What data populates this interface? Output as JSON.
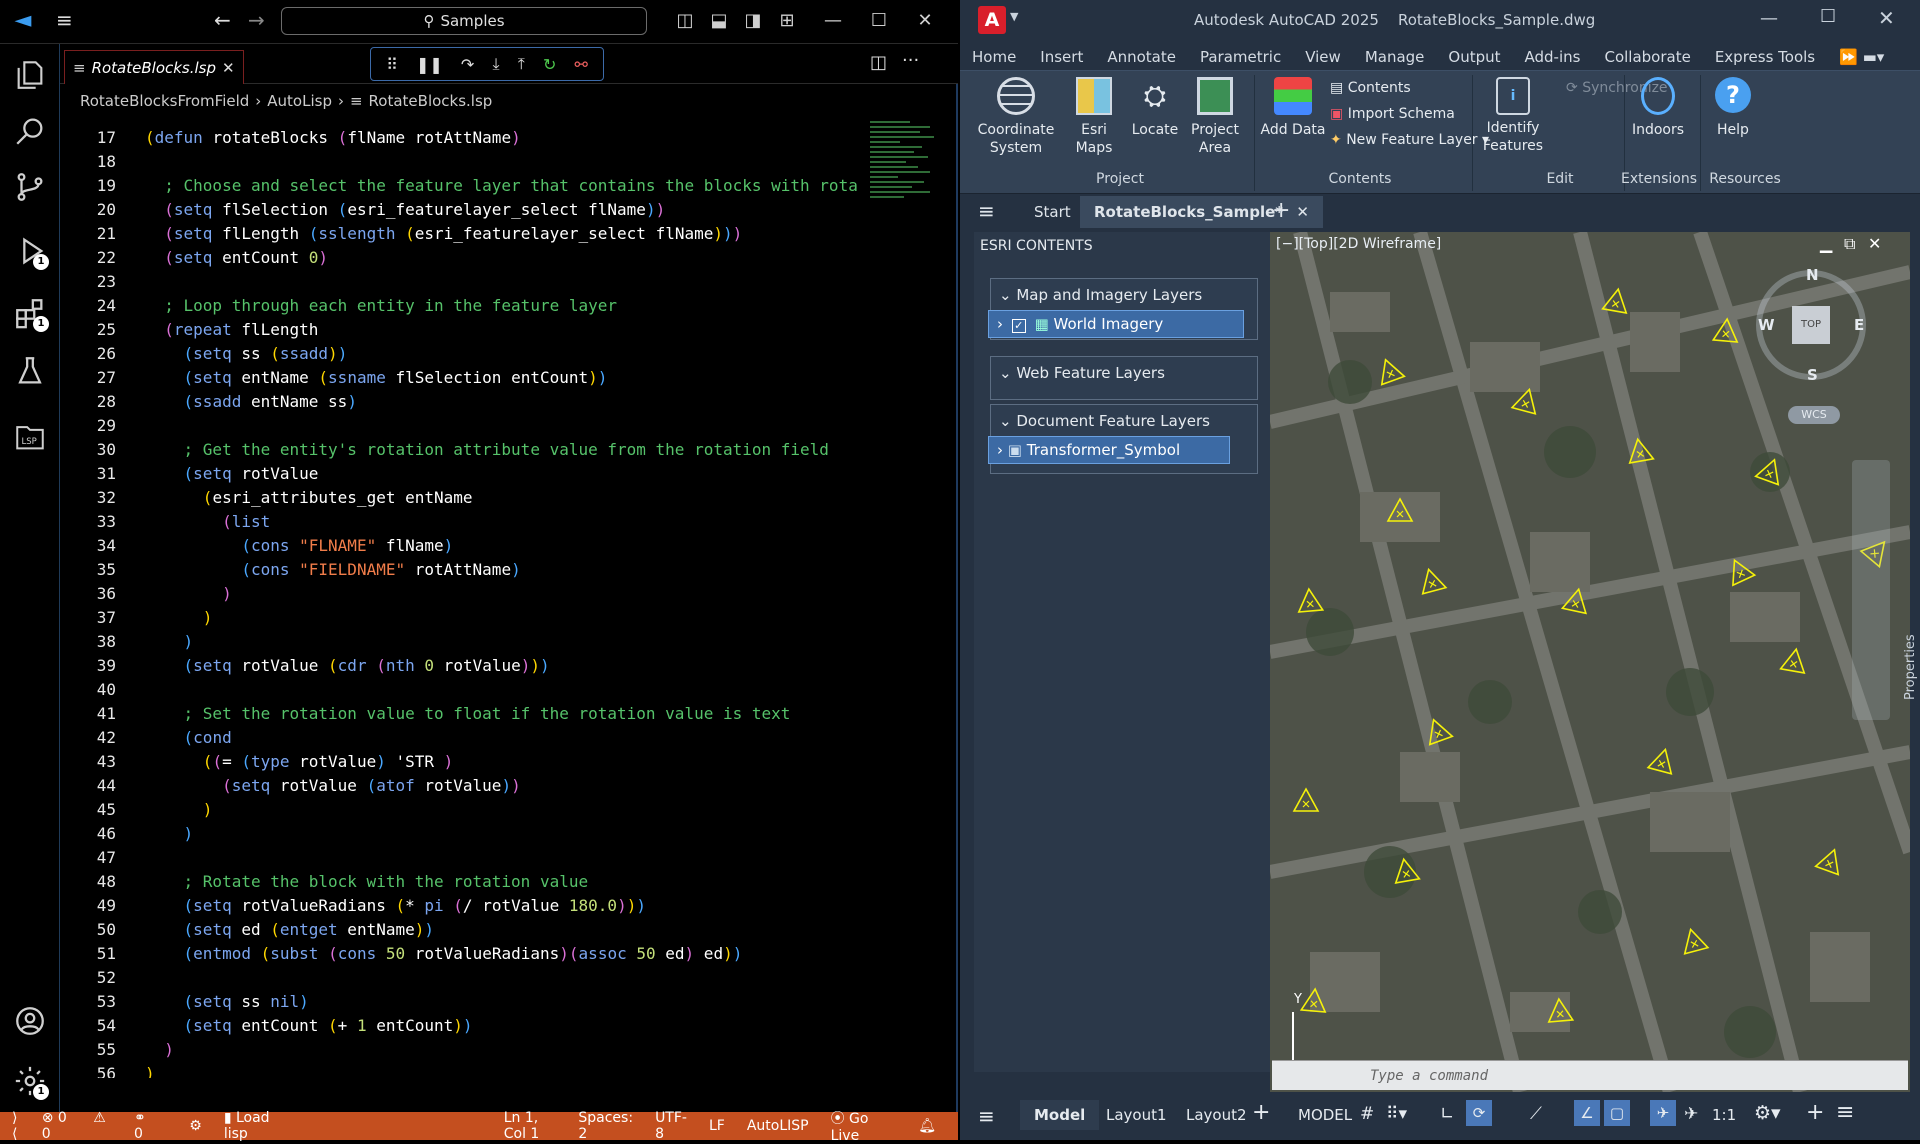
{
  "vscode": {
    "search_label": "Samples",
    "tab": {
      "filename": "RotateBlocks.lsp",
      "close": "✕"
    },
    "breadcrumb": [
      "RotateBlocksFromField",
      "AutoLisp",
      "RotateBlocks.lsp"
    ],
    "activity_badges": {
      "run": "1",
      "extensions": "1",
      "settings": "1"
    },
    "code_lines": [
      {
        "n": "17",
        "html": "<span class='p1'>(</span><span class='kw'>defun</span> rotateBlocks <span class='p2'>(</span>flName rotAttName<span class='p2'>)</span>"
      },
      {
        "n": "18",
        "html": ""
      },
      {
        "n": "19",
        "html": "  <span class='cm'>; Choose and select the feature layer that contains the blocks with rota</span>"
      },
      {
        "n": "20",
        "html": "  <span class='p2'>(</span><span class='kw'>setq</span> flSelection <span class='p3'>(</span>esri_featurelayer_select flName<span class='p3'>)</span><span class='p2'>)</span>"
      },
      {
        "n": "21",
        "html": "  <span class='p2'>(</span><span class='kw'>setq</span> flLength <span class='p3'>(</span><span class='kw'>sslength</span> <span class='p1'>(</span>esri_featurelayer_select flName<span class='p1'>)</span><span class='p3'>)</span><span class='p2'>)</span>"
      },
      {
        "n": "22",
        "html": "  <span class='p2'>(</span><span class='kw'>setq</span> entCount <span class='nm'>0</span><span class='p2'>)</span>"
      },
      {
        "n": "23",
        "html": ""
      },
      {
        "n": "24",
        "html": "  <span class='cm'>; Loop through each entity in the feature layer</span>"
      },
      {
        "n": "25",
        "html": "  <span class='p2'>(</span><span class='kw'>repeat</span> flLength"
      },
      {
        "n": "26",
        "html": "    <span class='p3'>(</span><span class='kw'>setq</span> ss <span class='p1'>(</span><span class='kw'>ssadd</span><span class='p1'>)</span><span class='p3'>)</span>"
      },
      {
        "n": "27",
        "html": "    <span class='p3'>(</span><span class='kw'>setq</span> entName <span class='p1'>(</span><span class='kw'>ssname</span> flSelection entCount<span class='p1'>)</span><span class='p3'>)</span>"
      },
      {
        "n": "28",
        "html": "    <span class='p3'>(</span><span class='kw'>ssadd</span> entName ss<span class='p3'>)</span>"
      },
      {
        "n": "29",
        "html": ""
      },
      {
        "n": "30",
        "html": "    <span class='cm'>; Get the entity's rotation attribute value from the rotation field</span>"
      },
      {
        "n": "31",
        "html": "    <span class='p3'>(</span><span class='kw'>setq</span> rotValue"
      },
      {
        "n": "32",
        "html": "      <span class='p1'>(</span>esri_attributes_get entName"
      },
      {
        "n": "33",
        "html": "        <span class='p2'>(</span><span class='kw'>list</span>"
      },
      {
        "n": "34",
        "html": "          <span class='p3'>(</span><span class='kw'>cons</span> <span class='st'>\"FLNAME\"</span> flName<span class='p3'>)</span>"
      },
      {
        "n": "35",
        "html": "          <span class='p3'>(</span><span class='kw'>cons</span> <span class='st'>\"FIELDNAME\"</span> rotAttName<span class='p3'>)</span>"
      },
      {
        "n": "36",
        "html": "        <span class='p2'>)</span>"
      },
      {
        "n": "37",
        "html": "      <span class='p1'>)</span>"
      },
      {
        "n": "38",
        "html": "    <span class='p3'>)</span>"
      },
      {
        "n": "39",
        "html": "    <span class='p3'>(</span><span class='kw'>setq</span> rotValue <span class='p1'>(</span><span class='kw'>cdr</span> <span class='p2'>(</span><span class='kw'>nth</span> <span class='nm'>0</span> rotValue<span class='p2'>)</span><span class='p1'>)</span><span class='p3'>)</span>"
      },
      {
        "n": "40",
        "html": ""
      },
      {
        "n": "41",
        "html": "    <span class='cm'>; Set the rotation value to float if the rotation value is text</span>"
      },
      {
        "n": "42",
        "html": "    <span class='p3'>(</span><span class='kw'>cond</span>"
      },
      {
        "n": "43",
        "html": "      <span class='p1'>(</span><span class='p2'>(</span>= <span class='p3'>(</span><span class='kw'>type</span> rotValue<span class='p3'>)</span> 'STR <span class='p2'>)</span>"
      },
      {
        "n": "44",
        "html": "        <span class='p2'>(</span><span class='kw'>setq</span> rotValue <span class='p3'>(</span><span class='kw'>atof</span> rotValue<span class='p3'>)</span><span class='p2'>)</span>"
      },
      {
        "n": "45",
        "html": "      <span class='p1'>)</span>"
      },
      {
        "n": "46",
        "html": "    <span class='p3'>)</span>"
      },
      {
        "n": "47",
        "html": ""
      },
      {
        "n": "48",
        "html": "    <span class='cm'>; Rotate the block with the rotation value</span>"
      },
      {
        "n": "49",
        "html": "    <span class='p3'>(</span><span class='kw'>setq</span> rotValueRadians <span class='p1'>(</span>* <span class='kw'>pi</span> <span class='p2'>(</span>/ rotValue <span class='nm'>180.0</span><span class='p2'>)</span><span class='p1'>)</span><span class='p3'>)</span>"
      },
      {
        "n": "50",
        "html": "    <span class='p3'>(</span><span class='kw'>setq</span> ed <span class='p1'>(</span><span class='kw'>entget</span> entName<span class='p1'>)</span><span class='p3'>)</span>"
      },
      {
        "n": "51",
        "html": "    <span class='p3'>(</span><span class='kw'>entmod</span> <span class='p1'>(</span><span class='kw'>subst</span> <span class='p2'>(</span><span class='kw'>cons</span> <span class='nm'>50</span> rotValueRadians<span class='p2'>)</span><span class='p2'>(</span><span class='kw'>assoc</span> <span class='nm'>50</span> ed<span class='p2'>)</span> ed<span class='p1'>)</span><span class='p3'>)</span>"
      },
      {
        "n": "52",
        "html": ""
      },
      {
        "n": "53",
        "html": "    <span class='p3'>(</span><span class='kw'>setq</span> ss <span class='kw'>nil</span><span class='p3'>)</span>"
      },
      {
        "n": "54",
        "html": "    <span class='p3'>(</span><span class='kw'>setq</span> entCount <span class='p1'>(</span>+ <span class='nm'>1</span> entCount<span class='p1'>)</span><span class='p3'>)</span>"
      },
      {
        "n": "55",
        "html": "  <span class='p2'>)</span>"
      },
      {
        "n": "56",
        "html": "<span class='p1'>)</span>"
      }
    ],
    "status": {
      "errors": "0",
      "warnings": "0",
      "ports": "0",
      "load_lisp": "Load lisp",
      "position": "Ln 1, Col 1",
      "spaces": "Spaces: 2",
      "encoding": "UTF-8",
      "eol": "LF",
      "language": "AutoLISP",
      "go_live": "Go Live"
    },
    "colors": {
      "statusbar": "#c44f1f",
      "comment": "#56c26a",
      "keyword": "#7ca6f0"
    }
  },
  "autocad": {
    "title": "Autodesk AutoCAD 2025    RotateBlocks_Sample.dwg",
    "menu_tabs": [
      "Home",
      "Insert",
      "Annotate",
      "Parametric",
      "View",
      "Manage",
      "Output",
      "Add-ins",
      "Collaborate",
      "Express Tools"
    ],
    "ribbon": {
      "coordinate_system": "Coordinate System",
      "esri_maps": "Esri Maps",
      "locate": "Locate",
      "project_area": "Project Area",
      "add_data": "Add Data",
      "contents": "Contents",
      "import_schema": "Import Schema",
      "new_feature_layer": "New Feature Layer",
      "identify_features": "Identify Features",
      "synchronize": "Synchronize",
      "indoors": "Indoors",
      "help": "Help",
      "panel_project": "Project",
      "panel_contents": "Contents",
      "panel_edit": "Edit",
      "panel_extensions": "Extensions",
      "panel_resources": "Resources"
    },
    "file_tabs": {
      "start": "Start",
      "active": "RotateBlocks_Sample*"
    },
    "esri_panel": {
      "title": "ESRI CONTENTS",
      "group1": "Map and Imagery Layers",
      "layer1": "World Imagery",
      "group2": "Web Feature Layers",
      "group3": "Document Feature Layers",
      "layer3": "Transformer_Symbol"
    },
    "viewport": {
      "label": "[−][Top][2D Wireframe]",
      "compass": {
        "n": "N",
        "s": "S",
        "e": "E",
        "w": "W",
        "top": "TOP",
        "wcs": "WCS"
      },
      "y_axis": "Y"
    },
    "command_placeholder": "Type a command",
    "properties_label": "Properties",
    "layout_tabs": {
      "model": "Model",
      "layout1": "Layout1",
      "layout2": "Layout2"
    },
    "status": {
      "model": "MODEL",
      "scale": "1:1"
    }
  }
}
